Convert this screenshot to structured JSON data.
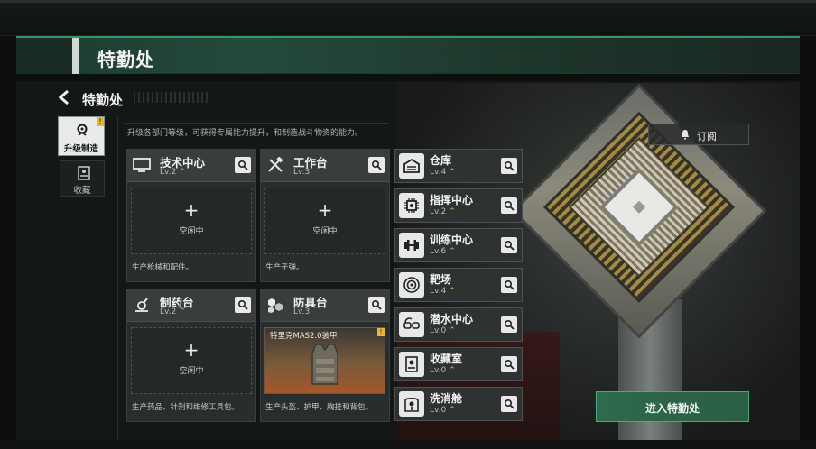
{
  "window": {
    "title": "特勤处"
  },
  "header": {
    "breadcrumb": "特勤处"
  },
  "nav": {
    "upgrade": {
      "label": "升级制造",
      "badge": "!"
    },
    "collect": {
      "label": "收藏"
    }
  },
  "description": "升级各部门等级，可获得专属能力提升，和制造战斗物资的能力。",
  "subscribe": {
    "label": "订阅"
  },
  "cards": [
    {
      "name": "技术中心",
      "level": "Lv.2",
      "slot_plus": "+",
      "slot_status": "空闲中",
      "footer": "生产枪械和配件。",
      "icon": "monitor-icon"
    },
    {
      "name": "工作台",
      "level": "Lv.3",
      "slot_plus": "+",
      "slot_status": "空闲中",
      "footer": "生产子弹。",
      "icon": "tools-icon"
    },
    {
      "name": "制药台",
      "level": "Lv.2",
      "slot_plus": "+",
      "slot_status": "空闲中",
      "footer": "生产药品、针剂和维修工具包。",
      "icon": "microscope-icon"
    },
    {
      "name": "防具台",
      "level": "Lv.3",
      "item_name": "特里克MAS2.0装甲",
      "item_badge": "!",
      "footer": "生产头盔、护甲、胸挂和背包。",
      "icon": "armor-parts-icon"
    }
  ],
  "rooms": [
    {
      "name": "仓库",
      "level": "Lv.4",
      "icon": "warehouse-icon"
    },
    {
      "name": "指挥中心",
      "level": "Lv.2",
      "icon": "chip-icon"
    },
    {
      "name": "训练中心",
      "level": "Lv.6",
      "icon": "dumbbell-icon"
    },
    {
      "name": "靶场",
      "level": "Lv.4",
      "icon": "target-icon"
    },
    {
      "name": "潜水中心",
      "level": "Lv.0",
      "icon": "diving-mask-icon"
    },
    {
      "name": "收藏室",
      "level": "Lv.0",
      "icon": "display-case-icon"
    },
    {
      "name": "洗消舱",
      "level": "Lv.0",
      "icon": "decon-icon"
    }
  ],
  "enter_button": {
    "label": "进入特勤处"
  },
  "colors": {
    "accent_green": "#2e9a6a",
    "upgrade_arrow": "#e0b842",
    "badge_yellow": "#e4b93a"
  }
}
